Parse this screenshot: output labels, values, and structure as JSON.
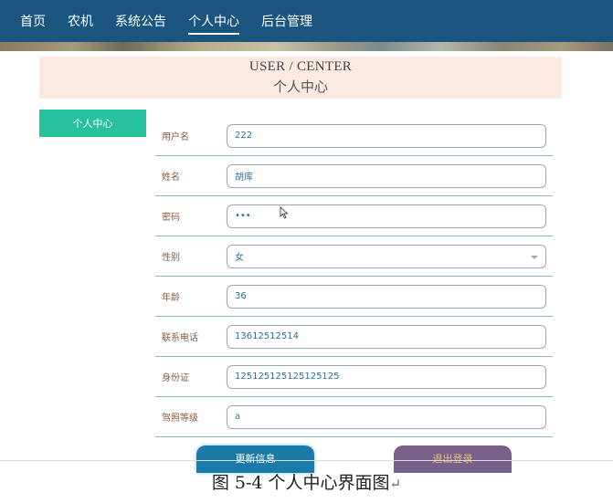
{
  "nav": {
    "items": [
      {
        "label": "首页"
      },
      {
        "label": "农机"
      },
      {
        "label": "系统公告"
      },
      {
        "label": "个人中心"
      },
      {
        "label": "后台管理"
      }
    ],
    "active": "个人中心",
    "background": "#1a5580"
  },
  "header": {
    "title_en": "USER / CENTER",
    "title_zh": "个人中心"
  },
  "side_menu": {
    "item": "个人中心",
    "color": "#26c29e"
  },
  "form": {
    "fields": [
      {
        "label": "用户名",
        "value": "222"
      },
      {
        "label": "姓名",
        "value": "胡库"
      },
      {
        "label": "密码",
        "value": "•••"
      },
      {
        "label": "性别",
        "value": "女"
      },
      {
        "label": "年龄",
        "value": "36"
      },
      {
        "label": "联系电话",
        "value": "13612512514"
      },
      {
        "label": "身份证",
        "value": "125125125125125125"
      },
      {
        "label": "驾照等级",
        "value": "a"
      }
    ]
  },
  "buttons": {
    "update": "更新信息",
    "logout": "退出登录"
  },
  "caption": {
    "text": "图 5-4 个人中心界面图",
    "return_mark": "↵"
  }
}
